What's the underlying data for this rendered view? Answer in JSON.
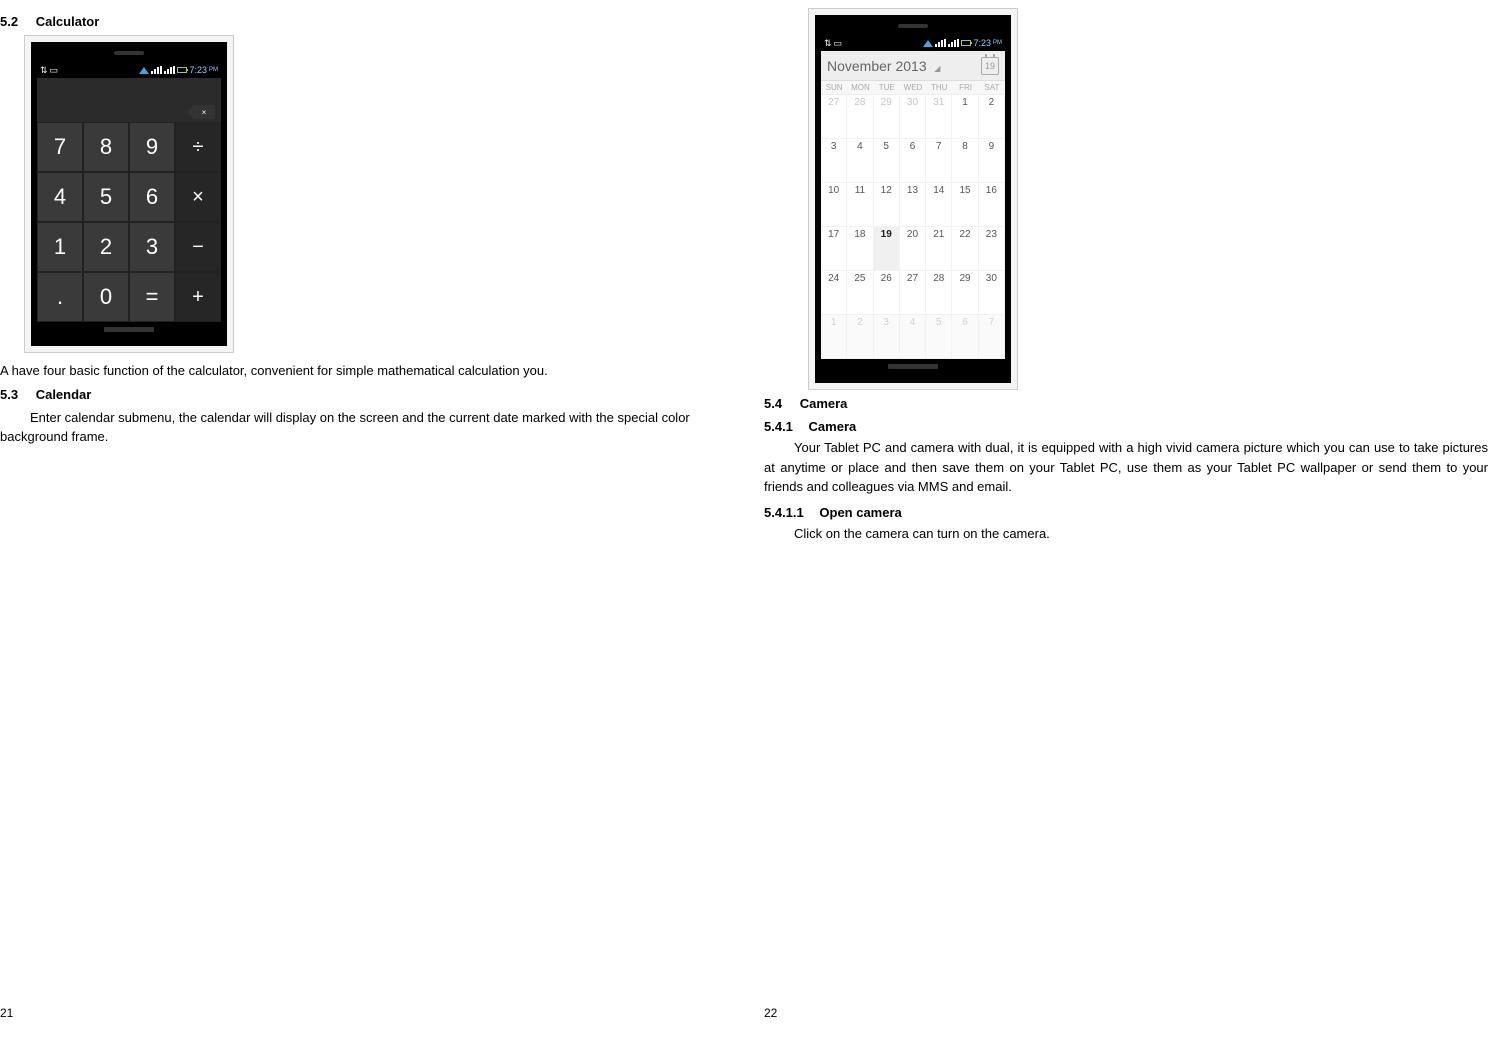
{
  "left": {
    "sec52": {
      "num": "5.2",
      "title": "Calculator"
    },
    "sec52_text": "A have four basic function of the calculator, convenient for simple mathematical calculation you.",
    "sec53": {
      "num": "5.3",
      "title": "Calendar"
    },
    "sec53_text": "Enter calendar submenu, the calendar will display on the screen and the current date marked with the special color background frame.",
    "page_num": "21"
  },
  "right": {
    "sec54": {
      "num": "5.4",
      "title": "Camera"
    },
    "sec541": {
      "num": "5.4.1",
      "title": "Camera"
    },
    "sec541_text": "Your Tablet PC and camera with dual, it is equipped with a high vivid camera picture which you can use to take pictures at anytime or place and then save them on your Tablet PC, use them as your Tablet PC wallpaper or send them to your friends and colleagues via MMS and email.",
    "sec5411": {
      "num": "5.4.1.1",
      "title": "Open camera"
    },
    "sec5411_text": "Click on the camera can turn on the camera.",
    "page_num": "22"
  },
  "status": {
    "time": "7:23",
    "pm": "PM"
  },
  "calc": {
    "keys": [
      "7",
      "8",
      "9",
      "÷",
      "4",
      "5",
      "6",
      "×",
      "1",
      "2",
      "3",
      "−",
      ".",
      "0",
      "=",
      "+"
    ]
  },
  "calendar": {
    "title": "November 2013",
    "today_badge": "19",
    "dow": [
      "SUN",
      "MON",
      "TUE",
      "WED",
      "THU",
      "FRI",
      "SAT"
    ],
    "weeks": [
      [
        {
          "d": "27",
          "o": true
        },
        {
          "d": "28",
          "o": true
        },
        {
          "d": "29",
          "o": true
        },
        {
          "d": "30",
          "o": true
        },
        {
          "d": "31",
          "o": true
        },
        {
          "d": "1"
        },
        {
          "d": "2"
        }
      ],
      [
        {
          "d": "3"
        },
        {
          "d": "4"
        },
        {
          "d": "5"
        },
        {
          "d": "6"
        },
        {
          "d": "7"
        },
        {
          "d": "8"
        },
        {
          "d": "9"
        }
      ],
      [
        {
          "d": "10"
        },
        {
          "d": "11"
        },
        {
          "d": "12"
        },
        {
          "d": "13"
        },
        {
          "d": "14"
        },
        {
          "d": "15"
        },
        {
          "d": "16"
        }
      ],
      [
        {
          "d": "17"
        },
        {
          "d": "18"
        },
        {
          "d": "19",
          "t": true
        },
        {
          "d": "20"
        },
        {
          "d": "21"
        },
        {
          "d": "22"
        },
        {
          "d": "23"
        }
      ],
      [
        {
          "d": "24"
        },
        {
          "d": "25"
        },
        {
          "d": "26"
        },
        {
          "d": "27"
        },
        {
          "d": "28"
        },
        {
          "d": "29"
        },
        {
          "d": "30"
        }
      ],
      [
        {
          "d": "1",
          "tr": true
        },
        {
          "d": "2",
          "tr": true
        },
        {
          "d": "3",
          "tr": true
        },
        {
          "d": "4",
          "tr": true
        },
        {
          "d": "5",
          "tr": true
        },
        {
          "d": "6",
          "tr": true
        },
        {
          "d": "7",
          "tr": true
        }
      ]
    ]
  }
}
